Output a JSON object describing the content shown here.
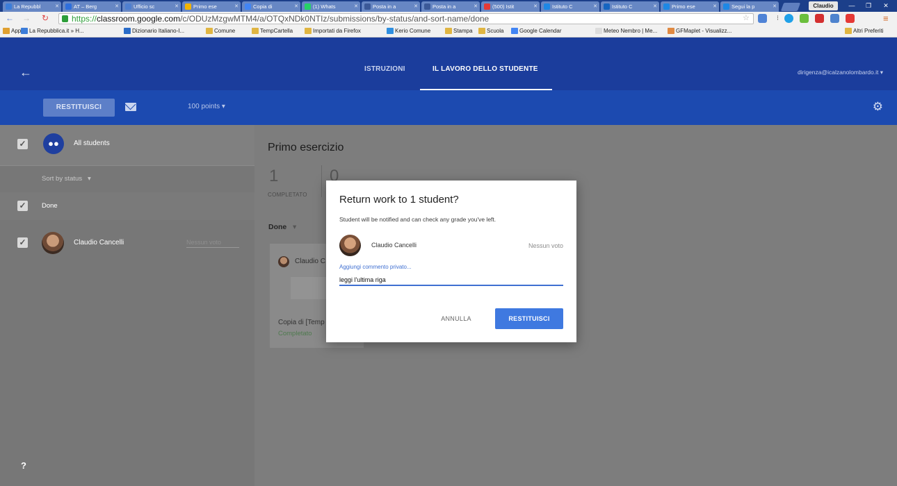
{
  "browser": {
    "tabs": [
      {
        "label": "La Repubbl",
        "color": "#3c7dd9"
      },
      {
        "label": "AT – Berg",
        "color": "#2f6fdc"
      },
      {
        "label": "Ufficio sc",
        "color": "#4f7fd0"
      },
      {
        "label": "Primo ese",
        "color": "#f4b400"
      },
      {
        "label": "Copia di",
        "color": "#4285f4"
      },
      {
        "label": "(1) Whats",
        "color": "#25d366"
      },
      {
        "label": "Posta in a",
        "color": "#3b5998"
      },
      {
        "label": "Posta in a",
        "color": "#3b5998"
      },
      {
        "label": "(500) Istit",
        "color": "#e53935"
      },
      {
        "label": "Istituto C",
        "color": "#1e88e5"
      },
      {
        "label": "Istituto C",
        "color": "#1565c0"
      },
      {
        "label": "Primo ese",
        "color": "#1e88e5"
      },
      {
        "label": "Segui la p",
        "color": "#1e88e5"
      }
    ],
    "profile": "Claudio",
    "url_scheme": "https://",
    "url_host": "classroom.google.com",
    "url_path": "/c/ODUzMzgwMTM4/a/OTQxNDk0NTIz/submissions/by-status/and-sort-name/done",
    "bookmarks": {
      "apps": "App",
      "items": [
        {
          "label": "La Repubblica.it » H...",
          "color": "#3c7dd9"
        },
        {
          "label": "Dizionario Italiano-I...",
          "color": "#2a6cc8"
        },
        {
          "label": "Comune",
          "color": "#e0b542"
        },
        {
          "label": "TempCartella",
          "color": "#e0b542"
        },
        {
          "label": "Importati da Firefox",
          "color": "#e0b542"
        },
        {
          "label": "Kerio Comune",
          "color": "#2f8fe0"
        },
        {
          "label": "Stampa",
          "color": "#e0b542"
        },
        {
          "label": "Scuola",
          "color": "#e0b542"
        },
        {
          "label": "Google Calendar",
          "color": "#4285f4"
        },
        {
          "label": "Meteo Nembro | Me...",
          "color": "#dddddd"
        },
        {
          "label": "GFMaplet - Visualizz...",
          "color": "#e08a42"
        }
      ],
      "other": "Altri Preferiti"
    }
  },
  "header": {
    "tabs": [
      "ISTRUZIONI",
      "IL LAVORO DELLO STUDENTE"
    ],
    "account": "dirigenza@icalzanolombardo.it"
  },
  "toolbar": {
    "return_label": "RESTITUISCI",
    "points": "100 points"
  },
  "sidebar": {
    "all_students": "All students",
    "sort": "Sort by status",
    "group": "Done",
    "student_name": "Claudio Cancelli",
    "student_grade": "Nessun voto",
    "help": "?"
  },
  "main": {
    "title": "Primo esercizio",
    "stat1_num": "1",
    "stat1_lbl": "COMPLETATO",
    "stat2_num": "0",
    "filter": "Done",
    "card_name": "Claudio C",
    "card_file": "Copia di [Temp",
    "card_status": "Completato"
  },
  "dialog": {
    "title": "Return work to 1 student?",
    "body": "Student will be notified and can check any grade you've left.",
    "student_name": "Claudio Cancelli",
    "student_grade": "Nessun voto",
    "comment_label": "Aggiungi commento privato...",
    "comment_value": "leggi l'ultima riga",
    "cancel": "ANNULLA",
    "confirm": "RESTITUISCI"
  }
}
